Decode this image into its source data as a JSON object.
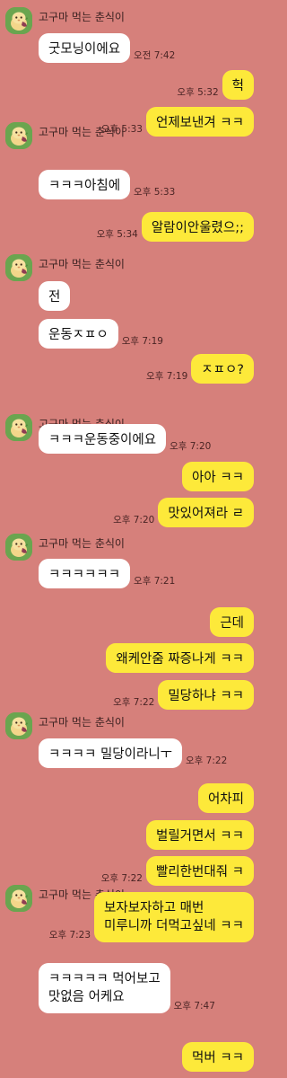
{
  "sender_name": "고구마 먹는 춘식이",
  "avatar_icon": "chunsik-sweet-potato-avatar",
  "messages": [
    {
      "side": "in",
      "text": "굿모닝이에요",
      "time": "오전 7:42"
    },
    {
      "side": "out",
      "text": "헉",
      "time": "오후 5:32"
    },
    {
      "side": "out",
      "text": "언제보낸겨 ㅋㅋ",
      "time": "오후 5:33"
    },
    {
      "side": "in",
      "text": "ㅋㅋㅋ아침에",
      "time": "오후 5:33"
    },
    {
      "side": "out",
      "text": "알람이안울렸으;;",
      "time": "오후 5:34"
    },
    {
      "side": "in",
      "text": "전",
      "time": ""
    },
    {
      "side": "in",
      "text": "운동ㅈㅍㅇ",
      "time": "오후 7:19"
    },
    {
      "side": "out",
      "text": "ㅈㅍㅇ?",
      "time": "오후 7:19"
    },
    {
      "side": "in",
      "text": "ㅋㅋㅋ운동중이에요",
      "time": "오후 7:20"
    },
    {
      "side": "out",
      "text": "아아 ㅋㅋ",
      "time": ""
    },
    {
      "side": "out",
      "text": "맛있어져라 ㄹ",
      "time": "오후 7:20"
    },
    {
      "side": "in",
      "text": "ㅋㅋㅋㅋㅋㅋ",
      "time": "오후 7:21"
    },
    {
      "side": "out",
      "text": "근데",
      "time": ""
    },
    {
      "side": "out",
      "text": "왜케안줌 짜증나게 ㅋㅋ",
      "time": ""
    },
    {
      "side": "out",
      "text": "밀당하냐 ㅋㅋ",
      "time": "오후 7:22"
    },
    {
      "side": "in",
      "text": "ㅋㅋㅋㅋ 밀당이라니ㅜ",
      "time": "오후 7:22"
    },
    {
      "side": "out",
      "text": "어차피",
      "time": ""
    },
    {
      "side": "out",
      "text": "벌릴거면서 ㅋㅋ",
      "time": ""
    },
    {
      "side": "out",
      "text": "빨리한번대줘 ㅋ",
      "time": "오후 7:22"
    },
    {
      "side": "out",
      "text": "보자보자하고 매번\n미루니까 더먹고싶네 ㅋㅋ",
      "time": "오후 7:23"
    },
    {
      "side": "in",
      "text": "ㅋㅋㅋㅋㅋ 먹어보고\n맛없음 어케요",
      "time": "오후 7:47"
    },
    {
      "side": "out",
      "text": "먹버 ㅋㅋ",
      "time": ""
    }
  ]
}
